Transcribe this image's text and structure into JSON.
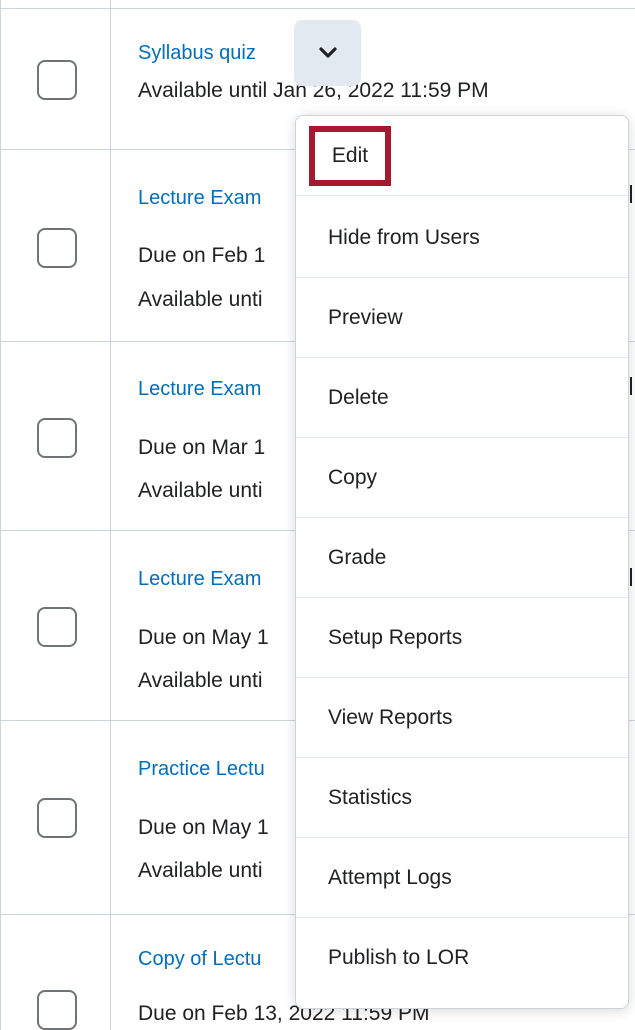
{
  "rows": [
    {
      "title": "Syllabus quiz",
      "line1": "Available until Jan 26, 2022 11:59 PM",
      "line2": ""
    },
    {
      "title": "Lecture Exam",
      "line1": "Due on Feb 1",
      "line2": "Available unti"
    },
    {
      "title": "Lecture Exam",
      "line1": "Due on Mar 1",
      "line2": "Available unti"
    },
    {
      "title": "Lecture Exam",
      "line1": "Due on May 1",
      "line2": "Available unti"
    },
    {
      "title": "Practice Lectu",
      "line1": "Due on May 1",
      "line2": "Available unti"
    },
    {
      "title": "Copy of Lectu",
      "line1": "Due on Feb 13, 2022 11:59 PM",
      "line2": ""
    }
  ],
  "menu": {
    "items": [
      "Edit",
      "Hide from Users",
      "Preview",
      "Delete",
      "Copy",
      "Grade",
      "Setup Reports",
      "View Reports",
      "Statistics",
      "Attempt Logs",
      "Publish to LOR"
    ]
  },
  "icons": {
    "dropdown": "chevron-down-icon"
  },
  "colors": {
    "link": "#006fbf",
    "highlight": "#a6192e",
    "button_bg": "#e3e9f1"
  }
}
